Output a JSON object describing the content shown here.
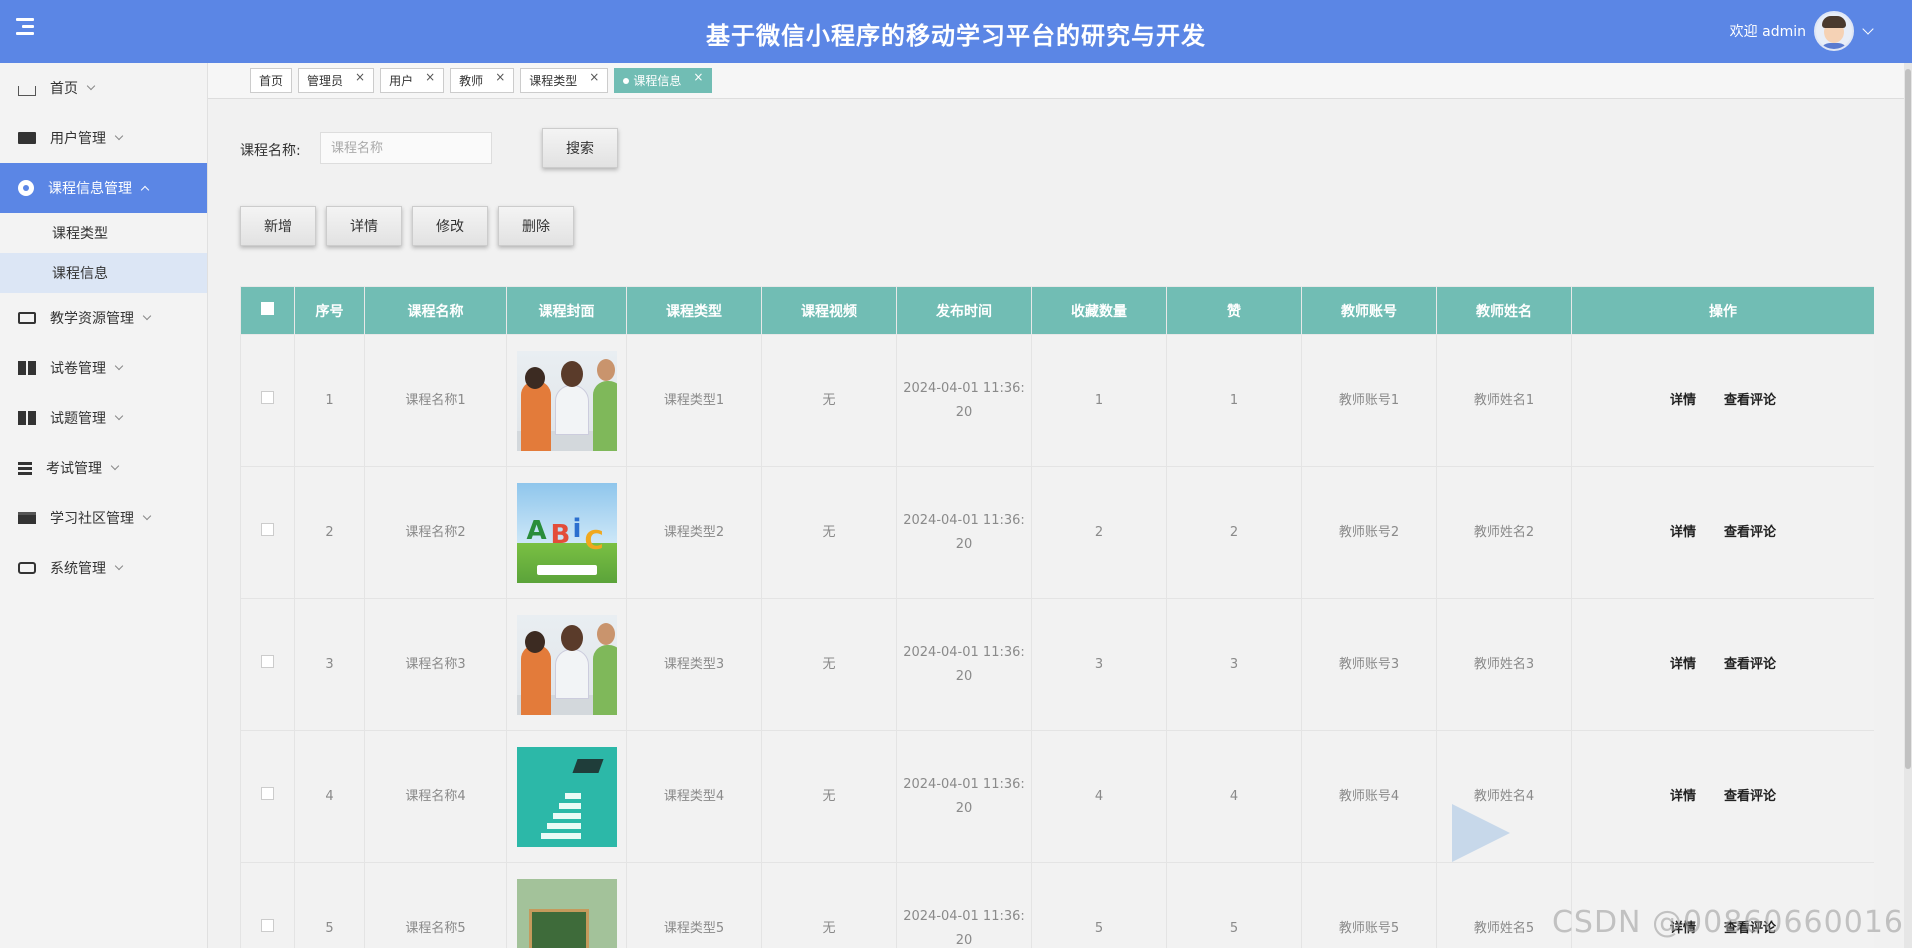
{
  "header": {
    "title": "基于微信小程序的移动学习平台的研究与开发",
    "welcome": "欢迎 admin"
  },
  "sidebar": {
    "items": [
      {
        "label": "首页",
        "icon": "home-icon"
      },
      {
        "label": "用户管理",
        "icon": "user-icon"
      },
      {
        "label": "课程信息管理",
        "icon": "course-icon",
        "active": true,
        "children": [
          {
            "label": "课程类型"
          },
          {
            "label": "课程信息",
            "active": true
          }
        ]
      },
      {
        "label": "教学资源管理",
        "icon": "resource-icon"
      },
      {
        "label": "试卷管理",
        "icon": "paper-icon"
      },
      {
        "label": "试题管理",
        "icon": "question-icon"
      },
      {
        "label": "考试管理",
        "icon": "exam-icon"
      },
      {
        "label": "学习社区管理",
        "icon": "community-icon"
      },
      {
        "label": "系统管理",
        "icon": "system-icon"
      }
    ]
  },
  "tabs": [
    {
      "label": "首页",
      "closable": false
    },
    {
      "label": "管理员",
      "closable": true
    },
    {
      "label": "用户",
      "closable": true
    },
    {
      "label": "教师",
      "closable": true
    },
    {
      "label": "课程类型",
      "closable": true
    },
    {
      "label": "课程信息",
      "closable": true,
      "active": true
    }
  ],
  "search": {
    "label": "课程名称:",
    "placeholder": "课程名称",
    "button": "搜索"
  },
  "actions": {
    "add": "新增",
    "detail": "详情",
    "edit": "修改",
    "delete": "删除"
  },
  "table": {
    "columns": [
      "序号",
      "课程名称",
      "课程封面",
      "课程类型",
      "课程视频",
      "发布时间",
      "收藏数量",
      "赞",
      "教师账号",
      "教师姓名",
      "操作"
    ],
    "row_actions": [
      "详情",
      "查看评论"
    ],
    "rows": [
      {
        "no": "1",
        "name": "课程名称1",
        "cover": "people",
        "type": "课程类型1",
        "video": "无",
        "time1": "2024-04-01 11:36:",
        "time2": "20",
        "fav": "1",
        "like": "1",
        "account": "教师账号1",
        "teacher": "教师姓名1"
      },
      {
        "no": "2",
        "name": "课程名称2",
        "cover": "abc",
        "type": "课程类型2",
        "video": "无",
        "time1": "2024-04-01 11:36:",
        "time2": "20",
        "fav": "2",
        "like": "2",
        "account": "教师账号2",
        "teacher": "教师姓名2"
      },
      {
        "no": "3",
        "name": "课程名称3",
        "cover": "people",
        "type": "课程类型3",
        "video": "无",
        "time1": "2024-04-01 11:36:",
        "time2": "20",
        "fav": "3",
        "like": "3",
        "account": "教师账号3",
        "teacher": "教师姓名3"
      },
      {
        "no": "4",
        "name": "课程名称4",
        "cover": "stairs",
        "type": "课程类型4",
        "video": "无",
        "time1": "2024-04-01 11:36:",
        "time2": "20",
        "fav": "4",
        "like": "4",
        "account": "教师账号4",
        "teacher": "教师姓名4"
      },
      {
        "no": "5",
        "name": "课程名称5",
        "cover": "board",
        "type": "课程类型5",
        "video": "无",
        "time1": "2024-04-01 11:36:",
        "time2": "20",
        "fav": "5",
        "like": "5",
        "account": "教师账号5",
        "teacher": "教师姓名5"
      }
    ]
  },
  "watermark": "CSDN @00860660016",
  "colors": {
    "header": "#5b86e5",
    "table_header": "#71bdb4",
    "active_tab": "#71bdb4"
  }
}
